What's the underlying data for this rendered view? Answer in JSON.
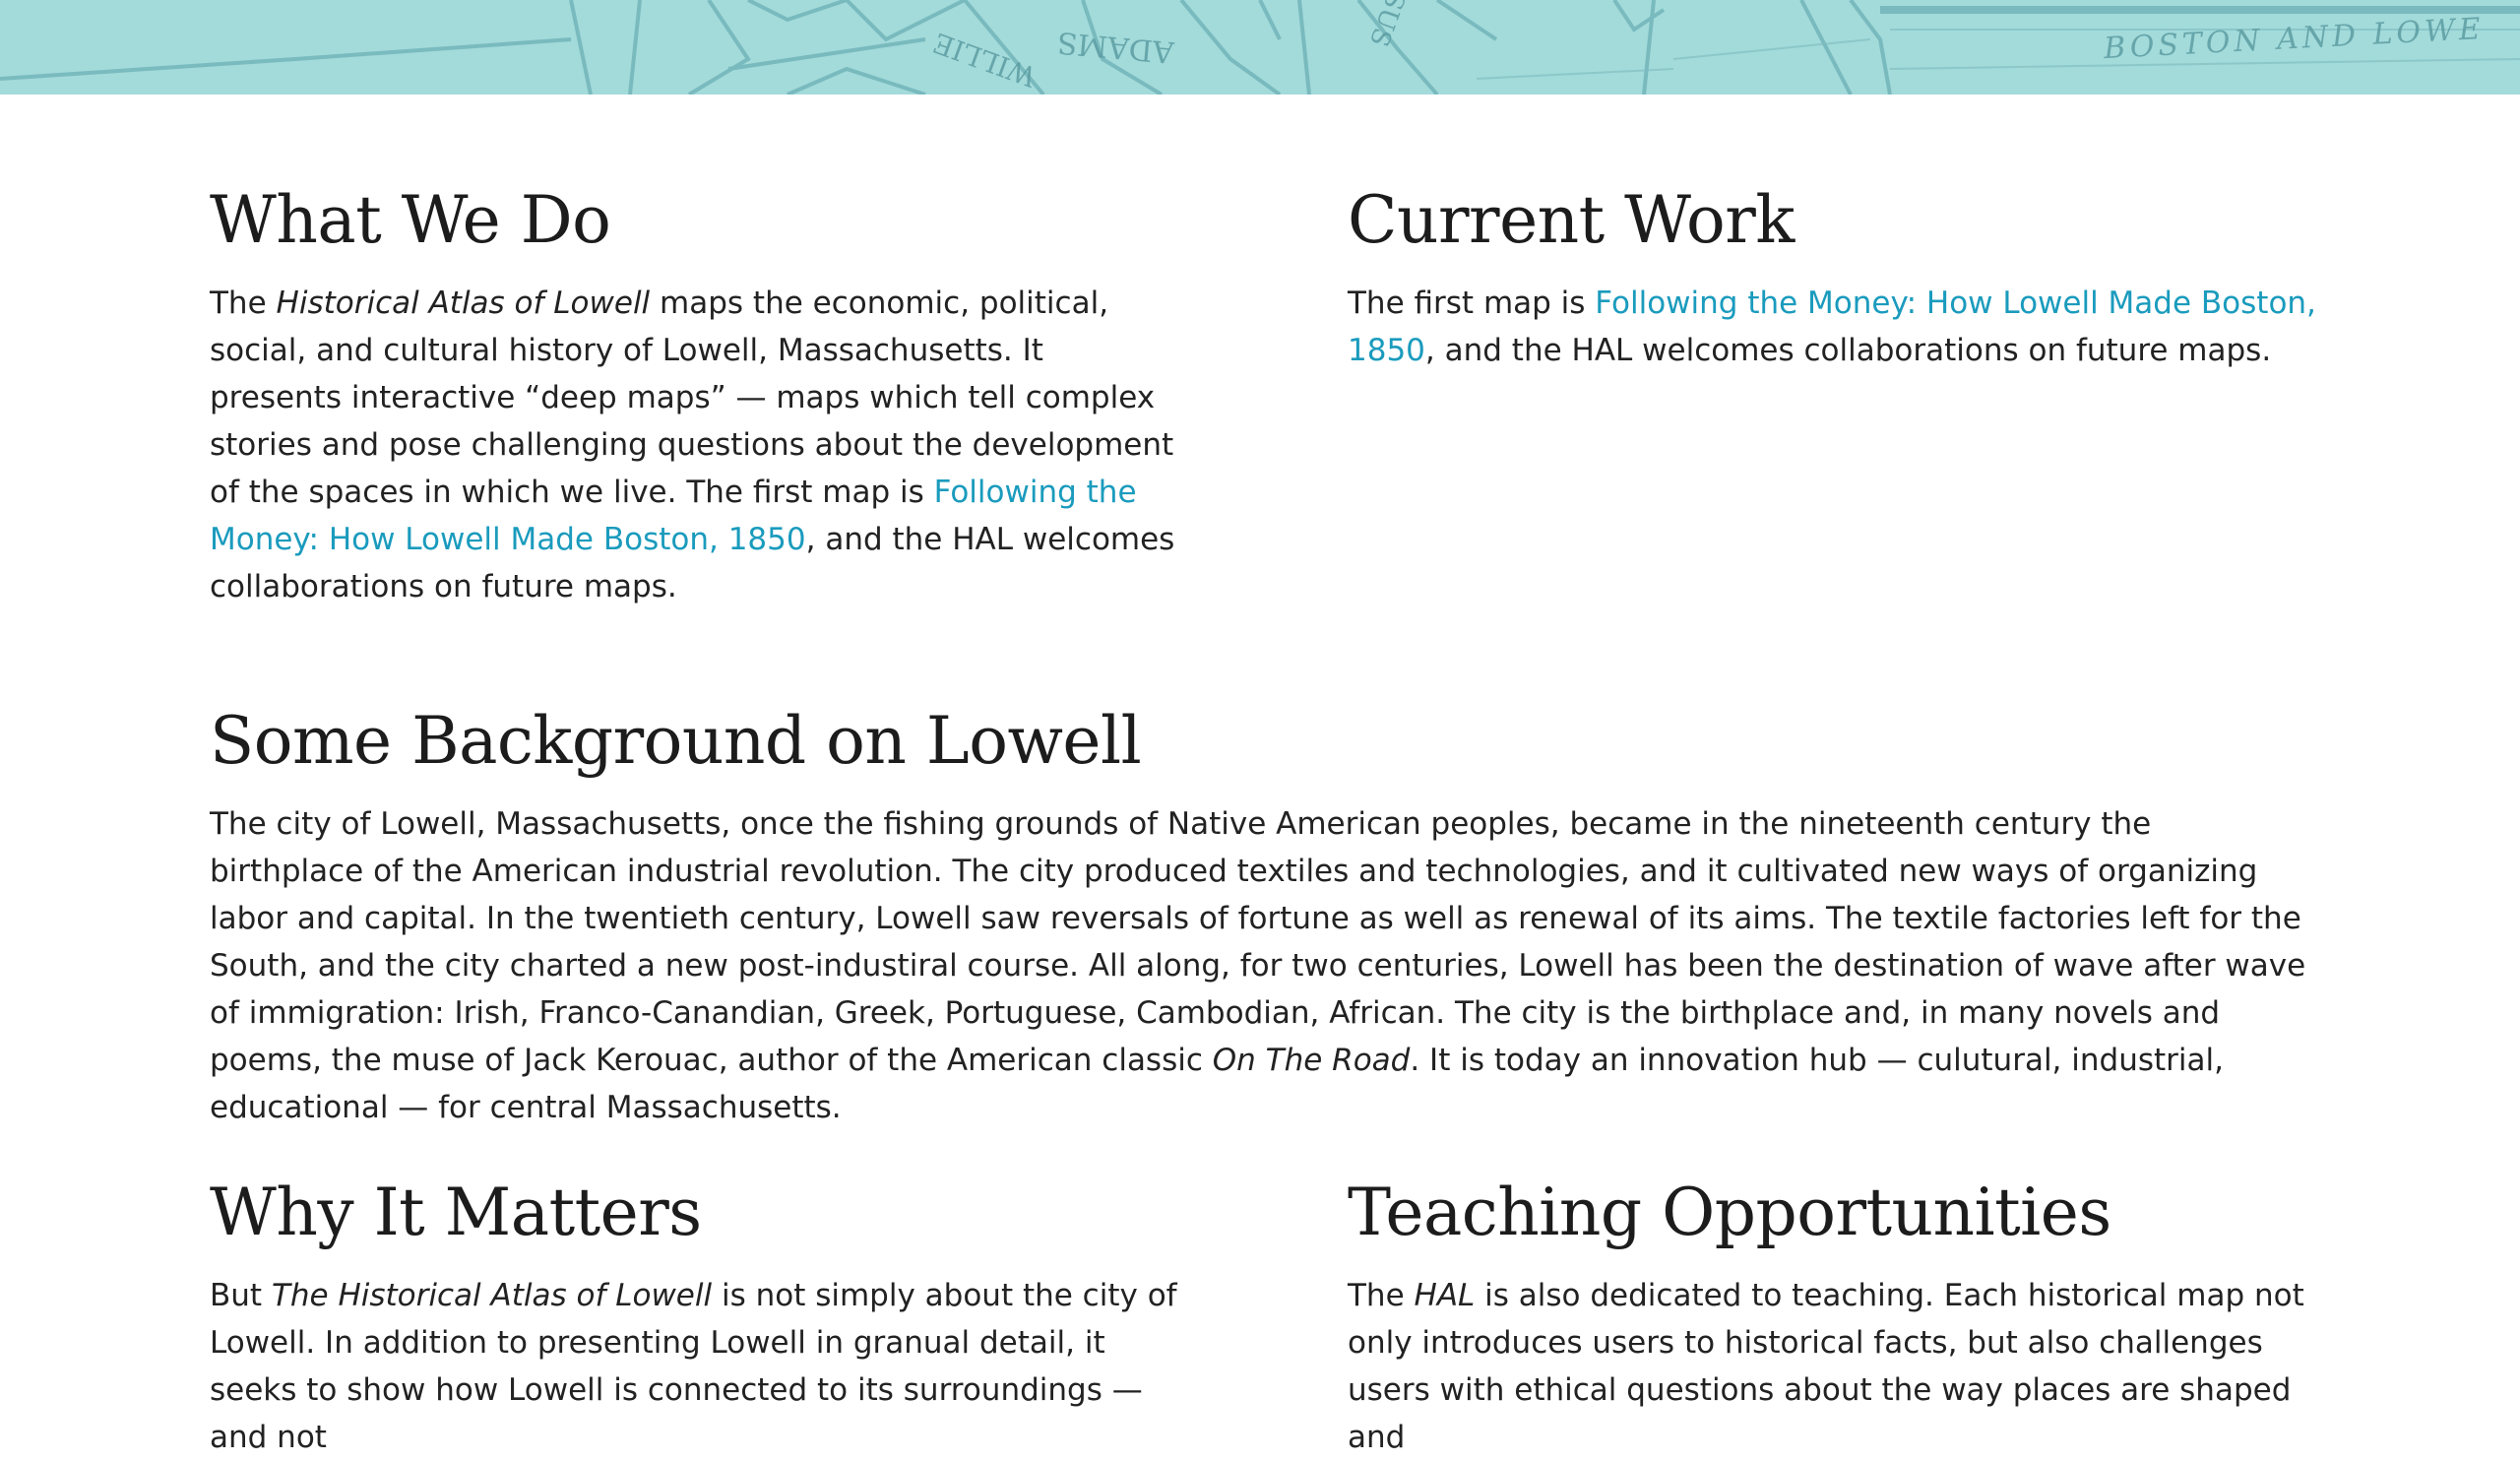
{
  "banner": {
    "map_labels": [
      "ADAMS",
      "WILLIE",
      "BOSTON AND LOWE",
      "SUS"
    ]
  },
  "what_we_do": {
    "heading": "What We Do",
    "p_prefix": "The ",
    "p_italic": "Historical Atlas of Lowell",
    "p_middle": " maps the economic, political, social, and cultural history of Lowell, Massachusetts. It presents interactive “deep maps” — maps which tell complex stories and pose challenging questions about the development of the spaces in which we live. The first map is ",
    "link": "Following the Money: How Lowell Made Boston, 1850",
    "p_suffix": ", and the HAL welcomes collaborations on future maps."
  },
  "current_work": {
    "heading": "Current Work",
    "p_prefix": "The first map is ",
    "link": "Following the Money: How Lowell Made Boston, 1850",
    "p_suffix": ", and the HAL welcomes collaborations on future maps."
  },
  "background": {
    "heading": "Some Background on Lowell",
    "p_prefix": "The city of Lowell, Massachusetts, once the fishing grounds of Native American peoples, became in the nineteenth century the birthplace of the American industrial revolution. The city produced textiles and technologies, and it cultivated new ways of organizing labor and capital. In the twentieth century, Lowell saw reversals of fortune as well as renewal of its aims. The textile factories left for the South, and the city charted a new post-industiral course. All along, for two centuries, Lowell has been the destination of wave after wave of immigration: Irish, Franco-Canandian, Greek, Portuguese, Cambodian, African. The city is the birthplace and, in many novels and poems, the muse of Jack Kerouac, author of the American classic ",
    "p_italic": "On The Road",
    "p_suffix": ". It is today an innovation hub — culutural, industrial, educational — for central Massachusetts."
  },
  "why_it_matters": {
    "heading": "Why It Matters",
    "p_prefix": "But ",
    "p_italic": "The Historical Atlas of Lowell",
    "p_suffix": " is not simply about the city of Lowell. In addition to presenting Lowell in granual detail, it seeks to show how Lowell is connected to its surroundings — and not"
  },
  "teaching": {
    "heading": "Teaching Opportunities",
    "p_prefix": "The ",
    "p_italic": "HAL",
    "p_suffix": " is also dedicated to teaching. Each historical map not only introduces users to historical facts, but also challenges users with ethical questions about the way places are shaped and"
  },
  "colors": {
    "banner": "#a3dada",
    "link": "#1a9bbd",
    "text": "#222222"
  }
}
